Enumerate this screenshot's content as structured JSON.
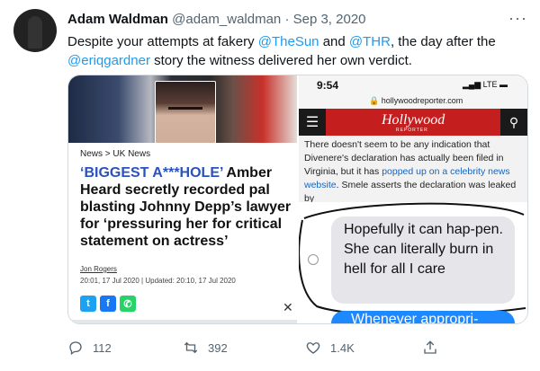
{
  "tweet": {
    "author_name": "Adam Waldman",
    "handle": "@adam_waldman",
    "separator": "·",
    "date": "Sep 3, 2020",
    "text_part1": "Despite your attempts at fakery ",
    "mention_sun": "@TheSun",
    "text_part2": " and ",
    "mention_thr": "@THR",
    "text_part3": ", the day after the ",
    "mention_eriq": "@eriqgardner",
    "text_part4": " story the witness delivered her own verdict."
  },
  "left_image": {
    "breadcrumb": "News > UK News",
    "headline_quote": "‘BIGGEST A***HOLE’",
    "headline_rest": " Amber Heard secretly recorded pal blasting Johnny Depp’s lawyer for ‘pressuring her for critical statement on actress’",
    "byline": "Jon Rogers",
    "dateline": "20:01, 17 Jul 2020  |  Updated: 20:10, 17 Jul 2020",
    "close_glyph": "✕"
  },
  "right_image": {
    "time": "9:54",
    "signal": "▂▄▆ LTE ▬",
    "url": "🔒 hollywoodreporter.com",
    "logo": "Hollywood",
    "logo_sub": "REPORTER",
    "article_before": "There doesn't seem to be any indication that Divenere's declaration has actually been filed in Virginia, but it has ",
    "article_link": "popped up on a celebrity news website",
    "article_after": ". Smele asserts the declaration was leaked by",
    "bubble_text": "Hopefully it can hap-pen. She can literally burn in hell for all I care",
    "bubble2_text": "Whenever appropri-"
  },
  "actions": {
    "reply_count": "112",
    "retweet_count": "392",
    "like_count": "1.4K"
  },
  "icons": [
    "avatar",
    "more-icon",
    "menu-icon",
    "search-icon",
    "twitter-icon",
    "facebook-icon",
    "whatsapp-icon",
    "close-icon",
    "reply-icon",
    "retweet-icon",
    "like-icon",
    "share-icon"
  ],
  "colors": {
    "link": "#1d9bf0",
    "thr_red": "#c41e1e",
    "meta": "#536471"
  }
}
